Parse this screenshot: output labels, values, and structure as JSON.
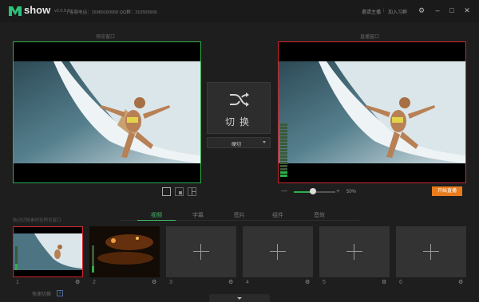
{
  "app": {
    "name": "show",
    "version": "v2.0.9.6",
    "contact": "| 客服电话：15989160958 QQ群：310509906",
    "links": [
      "邀请主播",
      "加入习群"
    ],
    "link_separator": "|"
  },
  "preview": {
    "label": "预览窗口"
  },
  "live": {
    "label": "直播窗口"
  },
  "switch": {
    "label": "切换",
    "transition": "硬切"
  },
  "volume": {
    "percent_text": "50%",
    "level": 0.5
  },
  "start_button": {
    "label": "开始直播"
  },
  "sources": {
    "caption": "拖动切换素材至预览窗口",
    "tabs": [
      "视频",
      "字幕",
      "图片",
      "组件",
      "音效"
    ],
    "active_tab": 0,
    "slots": [
      {
        "number": "1",
        "state": "video-surfer",
        "selected": true
      },
      {
        "number": "2",
        "state": "video-stage",
        "selected": false
      },
      {
        "number": "3",
        "state": "empty",
        "selected": false
      },
      {
        "number": "4",
        "state": "empty",
        "selected": false
      },
      {
        "number": "5",
        "state": "empty",
        "selected": false
      },
      {
        "number": "6",
        "state": "empty",
        "selected": false
      }
    ]
  },
  "quick_switch": {
    "label": "快速切换"
  },
  "colors": {
    "accent_green": "#2fae4a",
    "live_red": "#d0262a",
    "start_orange": "#e87b1c"
  }
}
